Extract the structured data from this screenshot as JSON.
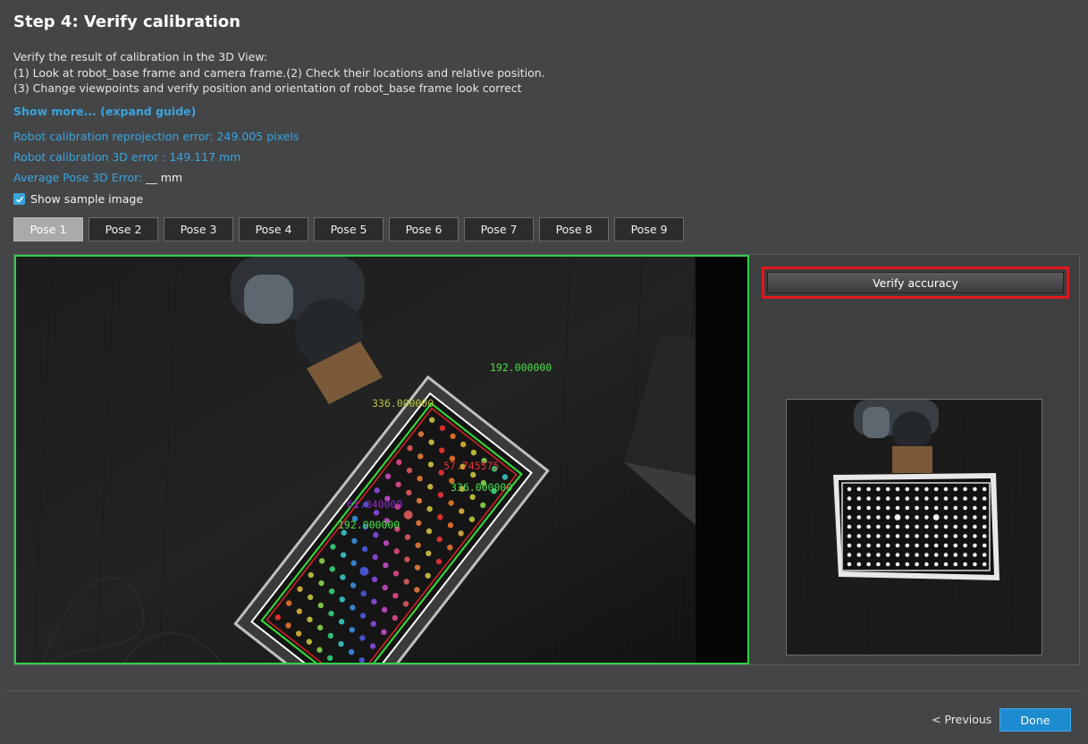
{
  "header": {
    "title": "Step 4: Verify calibration"
  },
  "instructions": {
    "line1": "Verify the result of calibration in the 3D View:",
    "line2": "(1) Look at robot_base frame and camera frame.(2) Check their locations and relative position.",
    "line3": "(3) Change viewpoints and verify position and orientation of robot_base frame look correct",
    "show_more": "Show more... (expand guide)"
  },
  "metrics": {
    "reprojection": "Robot calibration reprojection error: 249.005 pixels",
    "error_3d": "Robot calibration 3D error : 149.117 mm",
    "avg_pose_label": "Average Pose 3D Error:",
    "avg_pose_value": "__ mm"
  },
  "options": {
    "show_sample_image": "Show sample image",
    "show_sample_checked": true
  },
  "poses": {
    "active_index": 0,
    "tabs": [
      "Pose 1",
      "Pose 2",
      "Pose 3",
      "Pose 4",
      "Pose 5",
      "Pose 6",
      "Pose 7",
      "Pose 8",
      "Pose 9"
    ]
  },
  "viewer": {
    "annotations": {
      "top_right": "192.000000",
      "middle_upper": "336.000000",
      "middle_red": "57.745575",
      "right_green": "336.000000",
      "bottom_red": "61.840000",
      "bottom_green": "192.000000"
    }
  },
  "actions": {
    "verify_accuracy": "Verify accuracy",
    "previous": "< Previous",
    "done": "Done"
  },
  "colors": {
    "accent": "#3aa5e0",
    "viewer_border": "#2fd04a",
    "highlight_border": "#e0161c",
    "done_button": "#1d8bd0"
  }
}
